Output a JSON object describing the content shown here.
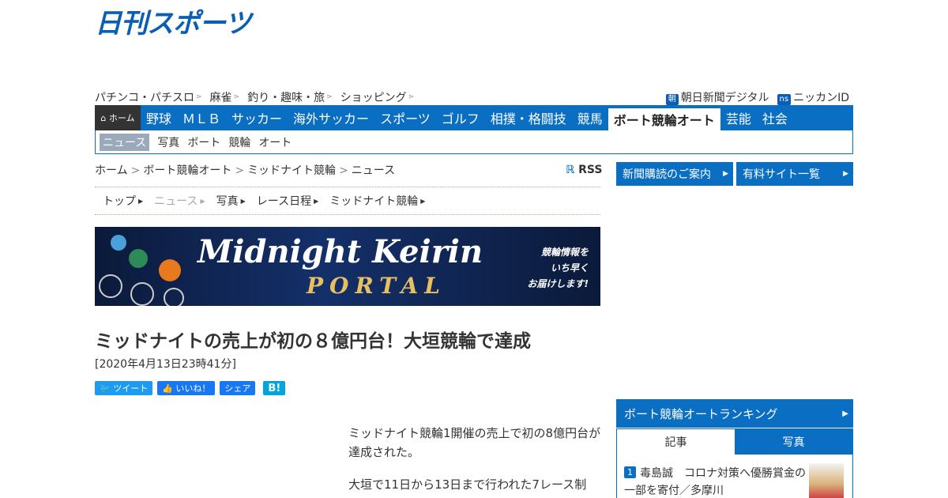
{
  "logo": "日刊スポーツ",
  "top_links": [
    "パチンコ・パチスロ",
    "麻雀",
    "釣り・趣味・旅",
    "ショッピング"
  ],
  "right_links": [
    {
      "badge": "朝",
      "label": "朝日新聞デジタル"
    },
    {
      "badge": "ns",
      "label": "ニッカンID"
    }
  ],
  "main_nav": {
    "home": "ホーム",
    "items": [
      "野球",
      "ＭＬＢ",
      "サッカー",
      "海外サッカー",
      "スポーツ",
      "ゴルフ",
      "相撲・格闘技",
      "競馬",
      "ボート競輪オート",
      "芸能",
      "社会"
    ],
    "active_index": 8
  },
  "sub_nav": [
    "ニュース",
    "写真",
    "ボート",
    "競輪",
    "オート"
  ],
  "breadcrumb": [
    "ホーム",
    "ボート競輪オート",
    "ミッドナイト競輪",
    "ニュース"
  ],
  "rss": "RSS",
  "section_tabs": [
    "トップ",
    "ニュース",
    "写真",
    "レース日程",
    "ミッドナイト競輪"
  ],
  "banner": {
    "title": "Midnight Keirin",
    "sub": "PORTAL",
    "tag1": "競輪情報を",
    "tag2": "いち早く",
    "tag3": "お届けします!"
  },
  "article": {
    "title": "ミッドナイトの売上が初の８億円台！大垣競輪で達成",
    "date": "[2020年4月13日23時41分]",
    "para1": "ミッドナイト競輪1開催の売上で初の8億円台が達成された。",
    "para2": "大垣で11日から13日まで行われた7レース制"
  },
  "social": {
    "tweet": "ツイート",
    "like": "いいね！",
    "share": "シェア",
    "hatena": "B!"
  },
  "sidebar": {
    "btn1": "新聞購読のご案内",
    "btn2": "有料サイト一覧",
    "ranking_title": "ボート競輪オートランキング",
    "tab_articles": "記事",
    "tab_photos": "写真",
    "rank1_num": "1",
    "rank1_text": "毒島誠　コロナ対策へ優勝賞金の一部を寄付／多摩川"
  },
  "colors": {
    "accent": "#0a6fc2",
    "brand": "#0a5fb4"
  }
}
